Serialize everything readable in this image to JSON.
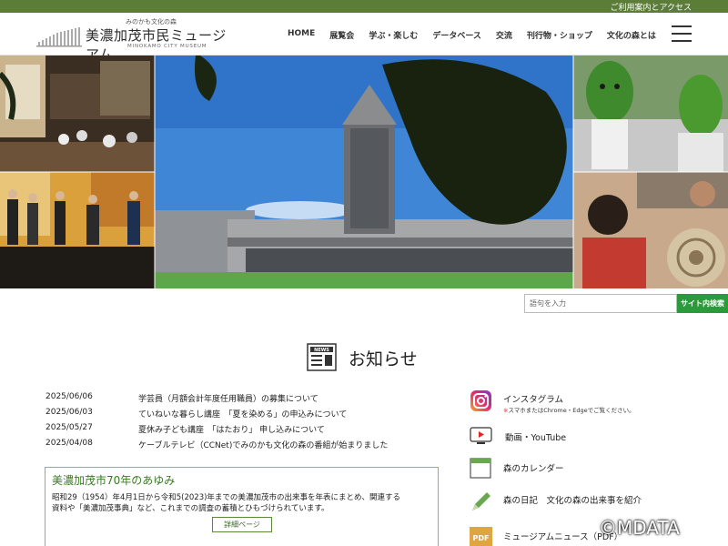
{
  "topbar": {
    "access_label": "ご利用案内とアクセス"
  },
  "logo": {
    "tagline": "みのかも文化の森",
    "name": "美濃加茂市民ミュージアム",
    "en": "MINOKAMO CITY MUSEUM"
  },
  "nav": {
    "items": [
      "HOME",
      "展覧会",
      "学ぶ・楽しむ",
      "データベース",
      "交流",
      "刊行物・ショップ",
      "文化の森とは"
    ]
  },
  "search": {
    "placeholder": "語句を入力",
    "button_label": "サイト内検索"
  },
  "news": {
    "icon_label": "NEWS",
    "title": "お知らせ",
    "items": [
      {
        "date": "2025/06/06",
        "text": "学芸員（月額会計年度任用職員）の募集について"
      },
      {
        "date": "2025/06/03",
        "text": "ていねいな暮らし講座　「夏を染める」の申込みについて"
      },
      {
        "date": "2025/05/27",
        "text": "夏休み子ども講座　「はたおり」 申し込みについて"
      },
      {
        "date": "2025/04/08",
        "text": "ケーブルテレビ（CCNet)でみのかも文化の森の番組が始まりました"
      }
    ]
  },
  "history": {
    "title": "美濃加茂市70年のあゆみ",
    "body_line1": "昭和29（1954）年4月1日から令和5(2023)年までの美濃加茂市の出来事を年表にまとめ、関連する",
    "body_line2": "資料や「美濃加茂事典」など、これまでの調査の蓄積とひもづけられています。",
    "button_label": "詳細ページ"
  },
  "side_links": [
    {
      "label": "インスタグラム",
      "note_mark": "※",
      "note": "スマホまたはChrome・Edgeでご覧ください。",
      "icon": "instagram-icon"
    },
    {
      "label": "動画・YouTube",
      "icon": "youtube-icon"
    },
    {
      "label": "森のカレンダー",
      "icon": "calendar-icon"
    },
    {
      "label": "森の日記　文化の森の出来事を紹介",
      "icon": "pencil-icon"
    },
    {
      "label": "ミュージアムニュース（PDF）",
      "icon": "pdf-icon",
      "icon_text": "PDF"
    }
  ],
  "copyright": "©MDATA",
  "colors": {
    "brand_green": "#5b7d38",
    "search_green": "#2a9a3a",
    "box_border": "#8fb56b"
  }
}
